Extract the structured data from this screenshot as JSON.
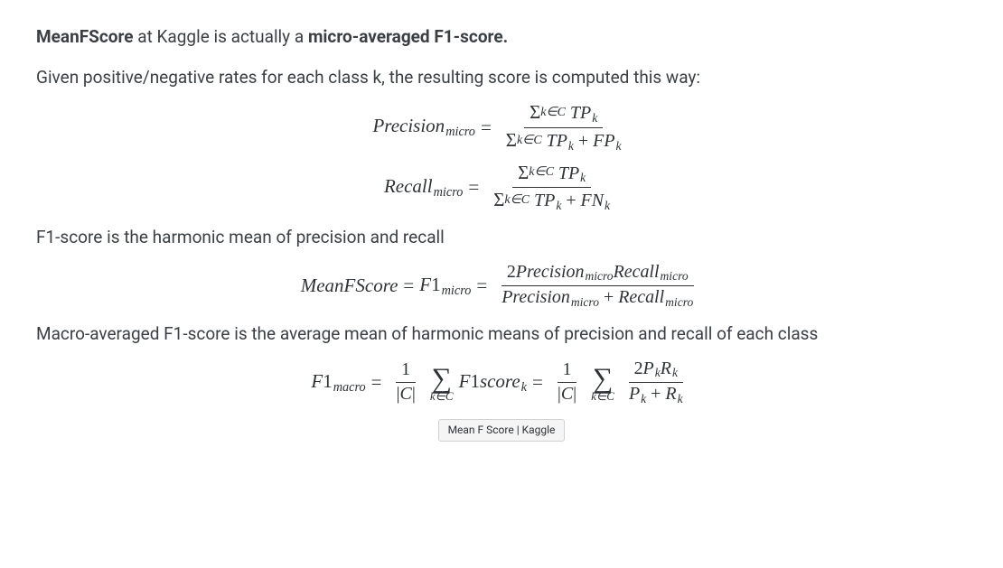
{
  "intro": {
    "bold1": "MeanFScore",
    "plain1": " at Kaggle is actually a ",
    "bold2": "micro-averaged F1-score.",
    "explain": "Given positive/negative rates for each class k, the resulting score is computed this way:"
  },
  "eq_precision": {
    "lhs_word": "Precision",
    "lhs_sub": "micro",
    "eq_sign": "=",
    "num_sum_limit": "k∈C",
    "num_term1": "TP",
    "num_term1_sub": "k",
    "den_sum_limit": "k∈C",
    "den_term1": "TP",
    "den_term1_sub": "k",
    "den_plus": "+",
    "den_term2": "FP",
    "den_term2_sub": "k"
  },
  "eq_recall": {
    "lhs_word": "Recall",
    "lhs_sub": "micro",
    "eq_sign": "=",
    "num_sum_limit": "k∈C",
    "num_term1": "TP",
    "num_term1_sub": "k",
    "den_sum_limit": "k∈C",
    "den_term1": "TP",
    "den_term1_sub": "k",
    "den_plus": "+",
    "den_term2": "FN",
    "den_term2_sub": "k"
  },
  "harmonic_text": "F1-score is the harmonic mean of precision and recall",
  "eq_f1micro": {
    "lhs_a": "MeanFScore",
    "eq1": "=",
    "lhs_b_word": "F",
    "lhs_b_one": "1",
    "lhs_b_sub": "micro",
    "eq2": "=",
    "num_prefix": "2",
    "num_p_word": "Precision",
    "num_p_sub": "micro",
    "num_r_word": "Recall",
    "num_r_sub": "micro",
    "den_p_word": "Precision",
    "den_p_sub": "micro",
    "den_plus": "+",
    "den_r_word": "Recall",
    "den_r_sub": "micro"
  },
  "macro_text": "Macro-averaged F1-score is the average mean of harmonic means of precision and recall of each class",
  "eq_f1macro": {
    "lhs_word": "F",
    "lhs_one": "1",
    "lhs_sub": "macro",
    "eq1": "=",
    "frac1_num": "1",
    "frac1_den_bar1": "|",
    "frac1_den_c": "C",
    "frac1_den_bar2": "|",
    "sum1_limit": "k∈C",
    "mid_word": "F",
    "mid_one": "1",
    "mid_score": "score",
    "mid_sub": "k",
    "eq2": "=",
    "frac2a_num": "1",
    "frac2a_den_bar1": "|",
    "frac2a_den_c": "C",
    "frac2a_den_bar2": "|",
    "sum2_limit": "k∈C",
    "frac2b_num_prefix": "2",
    "frac2b_num_p": "P",
    "frac2b_num_k1": "k",
    "frac2b_num_r": "R",
    "frac2b_num_k2": "k",
    "frac2b_den_p": "P",
    "frac2b_den_k1": "k",
    "frac2b_den_plus": "+",
    "frac2b_den_r": "R",
    "frac2b_den_k2": "k"
  },
  "chip_label": "Mean F Score | Kaggle"
}
